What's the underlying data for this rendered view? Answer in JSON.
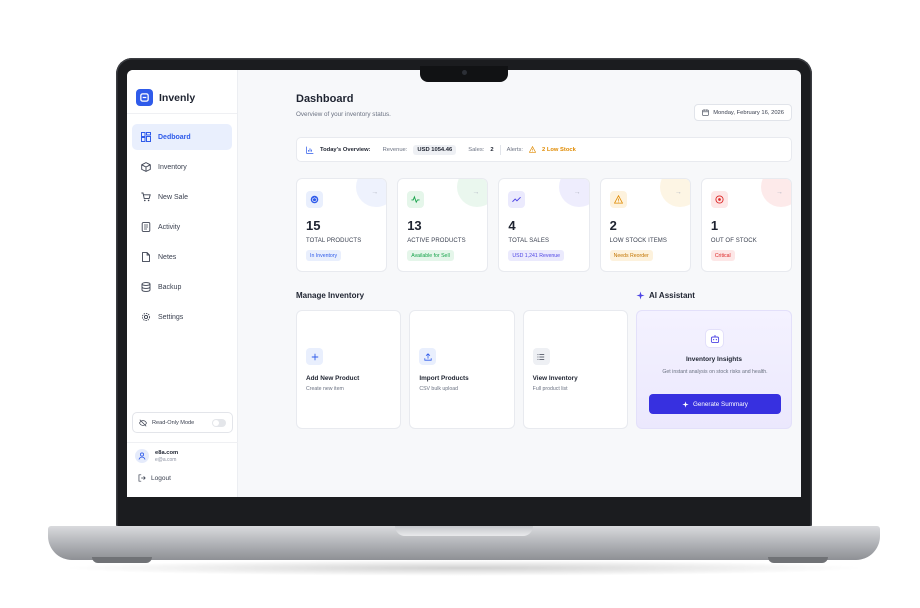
{
  "app": {
    "name": "Invenly"
  },
  "sidebar": {
    "items": [
      {
        "label": "Dedboard",
        "icon": "dashboard-icon",
        "active": true
      },
      {
        "label": "Inventory",
        "icon": "box-icon",
        "active": false
      },
      {
        "label": "New Sale",
        "icon": "cart-icon",
        "active": false
      },
      {
        "label": "Activity",
        "icon": "activity-icon",
        "active": false
      },
      {
        "label": "Netes",
        "icon": "notes-icon",
        "active": false
      },
      {
        "label": "Backup",
        "icon": "database-icon",
        "active": false
      },
      {
        "label": "Settings",
        "icon": "gear-icon",
        "active": false
      }
    ],
    "readonly_label": "Read-Only Mode",
    "user": {
      "name": "e8a.com",
      "email": "e@a.com"
    },
    "logout_label": "Logout"
  },
  "header": {
    "title": "Dashboard",
    "subtitle": "Overview of your inventory status.",
    "date": "Monday, February 16, 2026"
  },
  "overview": {
    "title": "Today's Overview:",
    "revenue_label": "Revenue:",
    "revenue_value": "USD 1054.46",
    "sales_label": "Sales:",
    "sales_value": "2",
    "alerts_label": "Alerts:",
    "alerts_value": "2 Low Stock"
  },
  "stats": [
    {
      "value": "15",
      "label": "TOTAL PRODUCTS",
      "chip": "In Inventory",
      "accent": "#2f5bea",
      "tint": "#e9effd"
    },
    {
      "value": "13",
      "label": "ACTIVE PRODUCTS",
      "chip": "Available for Sell",
      "accent": "#16a34a",
      "tint": "#e5f6ea"
    },
    {
      "value": "4",
      "label": "TOTAL SALES",
      "chip": "USD 1,241 Revenue",
      "accent": "#4f46e5",
      "tint": "#ebeafd"
    },
    {
      "value": "2",
      "label": "LOW STOCK ITEMS",
      "chip": "Needs Reorder",
      "accent": "#e08a00",
      "tint": "#fdf2dd"
    },
    {
      "value": "1",
      "label": "OUT OF STOCK",
      "chip": "Critical",
      "accent": "#dc2626",
      "tint": "#fde7e7"
    }
  ],
  "manage": {
    "title": "Manage Inventory",
    "cards": [
      {
        "title": "Add New Product",
        "desc": "Create new item",
        "icon": "plus-icon"
      },
      {
        "title": "Import Products",
        "desc": "CSV bulk upload",
        "icon": "upload-icon"
      },
      {
        "title": "View Inventory",
        "desc": "Full product list",
        "icon": "list-icon"
      }
    ]
  },
  "ai": {
    "title": "AI Assistant",
    "card_title": "Inventory Insights",
    "card_desc": "Get instant analysis on stock risks and health.",
    "button": "Generate Summary"
  }
}
